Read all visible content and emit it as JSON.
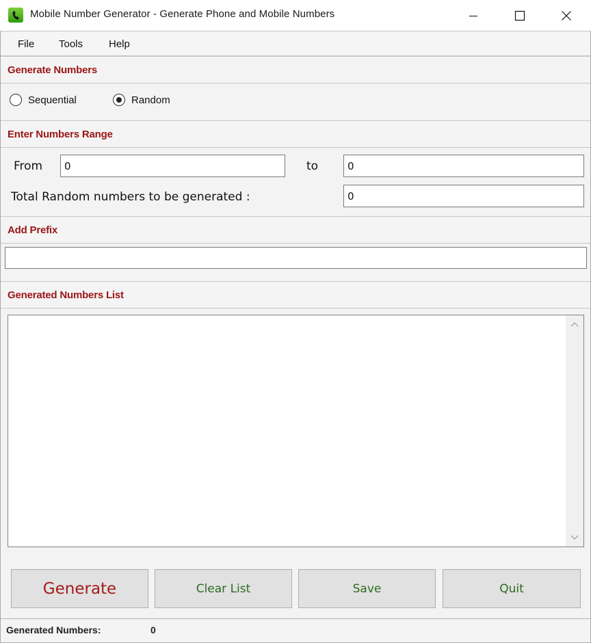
{
  "window": {
    "title": "Mobile Number Generator - Generate Phone and Mobile Numbers",
    "icon": "phone-app-icon",
    "controls": [
      "minimize",
      "maximize",
      "close"
    ]
  },
  "menu": {
    "items": [
      {
        "label": "File"
      },
      {
        "label": "Tools"
      },
      {
        "label": "Help"
      }
    ]
  },
  "generate_section": {
    "title": "Generate Numbers",
    "options": [
      {
        "label": "Sequential",
        "selected": false
      },
      {
        "label": "Random",
        "selected": true
      }
    ]
  },
  "range_section": {
    "title": "Enter Numbers Range",
    "from_label": "From",
    "from_value": "0",
    "to_label": "to",
    "to_value": "0",
    "total_label": "Total Random numbers to be generated :",
    "total_value": "0"
  },
  "prefix_section": {
    "title": "Add Prefix",
    "value": ""
  },
  "list_section": {
    "title": "Generated Numbers List",
    "items": []
  },
  "buttons": {
    "generate": "Generate",
    "clear": "Clear List",
    "save": "Save",
    "quit": "Quit"
  },
  "colors": {
    "section_title": "#9c1515",
    "generate_text": "#a51c1c",
    "button_text": "#2d6b1e"
  },
  "status": {
    "label": "Generated Numbers:",
    "count": "0"
  }
}
